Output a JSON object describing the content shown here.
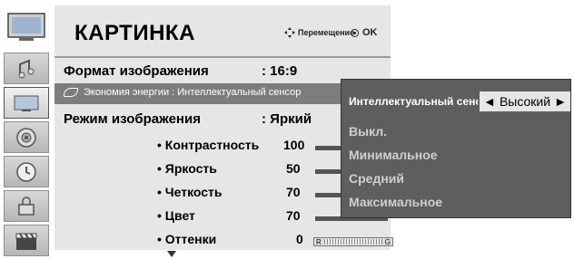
{
  "sidebar": {
    "items": [
      {
        "icon": "tv-icon"
      },
      {
        "icon": "audio-icon"
      },
      {
        "icon": "picture-icon"
      },
      {
        "icon": "sound-icon"
      },
      {
        "icon": "time-icon"
      },
      {
        "icon": "lock-icon"
      },
      {
        "icon": "media-icon"
      }
    ],
    "active_index": 1
  },
  "menu": {
    "title": "КАРТИНКА",
    "hint_move": "Перемещение",
    "hint_ok": "OK",
    "format_label": "Формат изображения",
    "format_value": ": 16:9",
    "energy_text": "Экономия энергии : Интеллектуальный сенсор",
    "mode_label": "Режим изображения",
    "mode_value": ": Яркий",
    "settings": [
      {
        "label": "• Контрастность",
        "value": "100"
      },
      {
        "label": "• Яркость",
        "value": "50"
      },
      {
        "label": "• Четкость",
        "value": "70"
      },
      {
        "label": "• Цвет",
        "value": "70"
      },
      {
        "label": "• Оттенки",
        "value": "0"
      }
    ],
    "tint_left": "R",
    "tint_right": "G"
  },
  "popup": {
    "header_label": "Интеллектуальный сенсор",
    "selected": "Высокий",
    "options": [
      "Выкл.",
      "Минимальное",
      "Средний",
      "Максимальное"
    ]
  }
}
